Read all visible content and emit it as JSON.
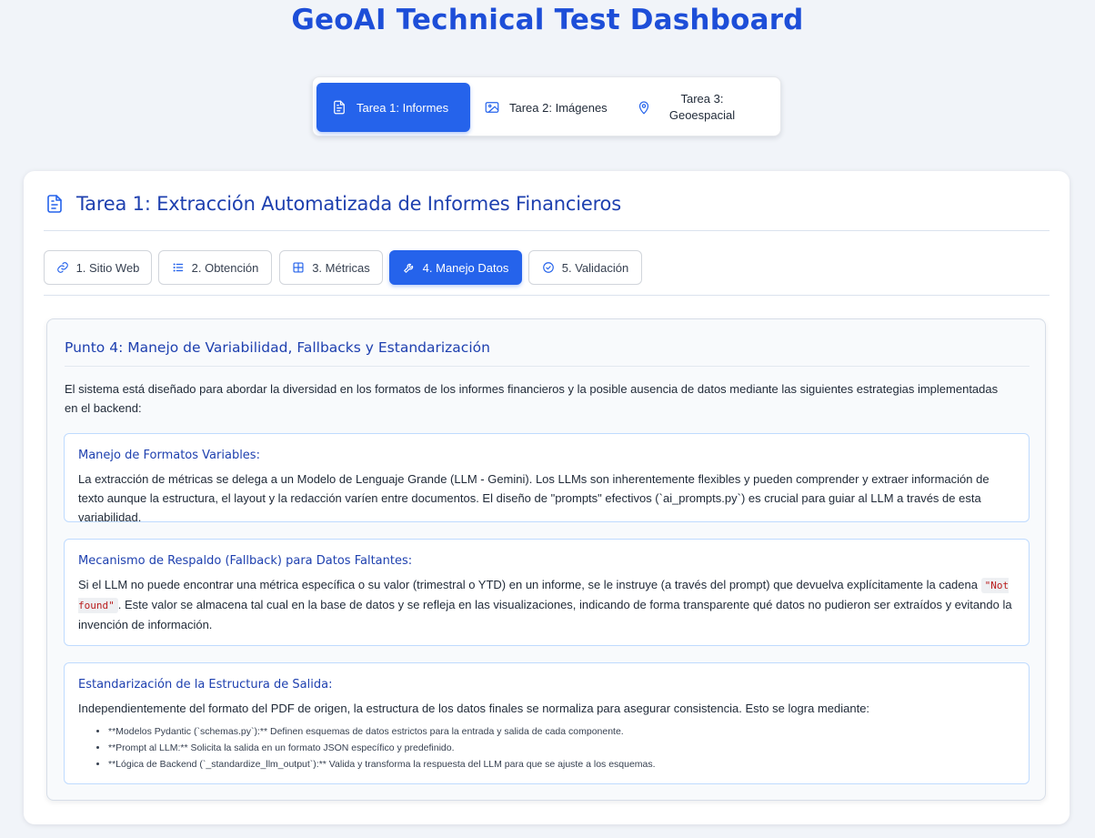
{
  "app": {
    "title": "GeoAI Technical Test Dashboard"
  },
  "main_tabs": [
    {
      "label": "Tarea 1: Informes",
      "icon": "document-report-icon",
      "active": true
    },
    {
      "label": "Tarea 2: Imágenes",
      "icon": "image-icon",
      "active": false
    },
    {
      "label_line1": "Tarea 3:",
      "label_line2": "Geoespacial",
      "icon": "map-pin-icon",
      "active": false
    }
  ],
  "card": {
    "title": "Tarea 1: Extracción Automatizada de Informes Financieros",
    "icon": "document-report-icon"
  },
  "sub_tabs": [
    {
      "label": "1. Sitio Web",
      "icon": "link-icon",
      "active": false
    },
    {
      "label": "2. Obtención",
      "icon": "list-icon",
      "active": false
    },
    {
      "label": "3. Métricas",
      "icon": "grid-icon",
      "active": false
    },
    {
      "label": "4. Manejo Datos",
      "icon": "wrench-icon",
      "active": true
    },
    {
      "label": "5. Validación",
      "icon": "check-circle-icon",
      "active": false
    }
  ],
  "panel": {
    "title": "Punto 4: Manejo de Variabilidad, Fallbacks y Estandarización",
    "intro": "El sistema está diseñado para abordar la diversidad en los formatos de los informes financieros y la posible ausencia de datos mediante las siguientes estrategias implementadas en el backend:",
    "sections": [
      {
        "title": "Manejo de Formatos Variables:",
        "text": "La extracción de métricas se delega a un Modelo de Lenguaje Grande (LLM - Gemini). Los LLMs son inherentemente flexibles y pueden comprender y extraer información de texto aunque la estructura, el layout y la redacción varíen entre documentos. El diseño de \"prompts\" efectivos (`ai_prompts.py`) es crucial para guiar al LLM a través de esta variabilidad."
      },
      {
        "title": "Mecanismo de Respaldo (Fallback) para Datos Faltantes:",
        "text_before": "Si el LLM no puede encontrar una métrica específica o su valor (trimestral o YTD) en un informe, se le instruye (a través del prompt) que devuelva explícitamente la cadena ",
        "code": "\"Not found\"",
        "text_after": ". Este valor se almacena tal cual en la base de datos y se refleja en las visualizaciones, indicando de forma transparente qué datos no pudieron ser extraídos y evitando la invención de información."
      },
      {
        "title": "Estandarización de la Estructura de Salida:",
        "text": "Independientemente del formato del PDF de origen, la estructura de los datos finales se normaliza para asegurar consistencia. Esto se logra mediante:",
        "bullets": [
          "**Modelos Pydantic (`schemas.py`):** Definen esquemas de datos estrictos para la entrada y salida de cada componente.",
          "**Prompt al LLM:** Solicita la salida en un formato JSON específico y predefinido.",
          "**Lógica de Backend (`_standardize_llm_output`):** Valida y transforma la respuesta del LLM para que se ajuste a los esquemas."
        ]
      }
    ]
  },
  "colors": {
    "accent": "#2563eb",
    "heading": "#1e40af",
    "background": "#f1f4f9",
    "code_text": "#b91c1c"
  }
}
